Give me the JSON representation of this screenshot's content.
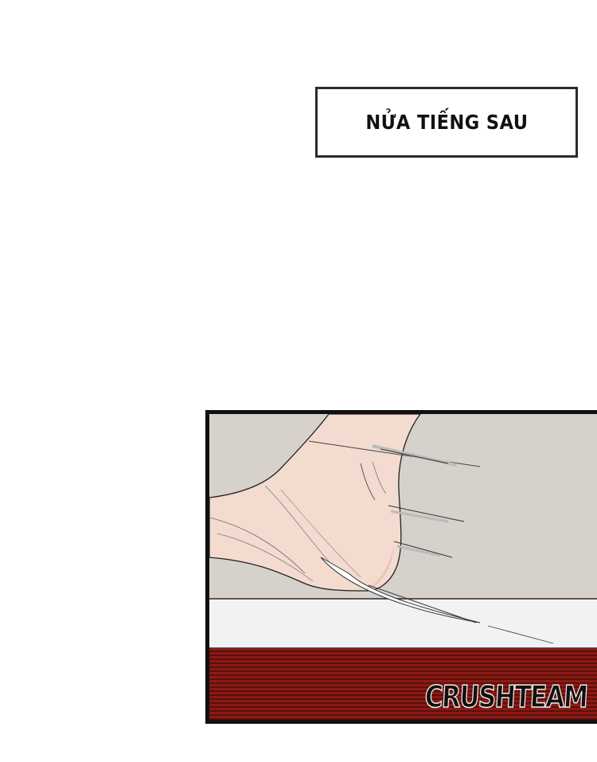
{
  "caption": {
    "text": "NỬA TIẾNG SAU"
  },
  "panel": {
    "watermark": "CRUSHTEAM",
    "colors": {
      "wall": "#d6d1cb",
      "skin": "#f3dbd0",
      "skin_shadow": "#ebc6b6",
      "floor": "#f2f2f2",
      "rug": "#8b1a14",
      "rug_line": "#3d0b08",
      "ink": "#111111"
    }
  }
}
